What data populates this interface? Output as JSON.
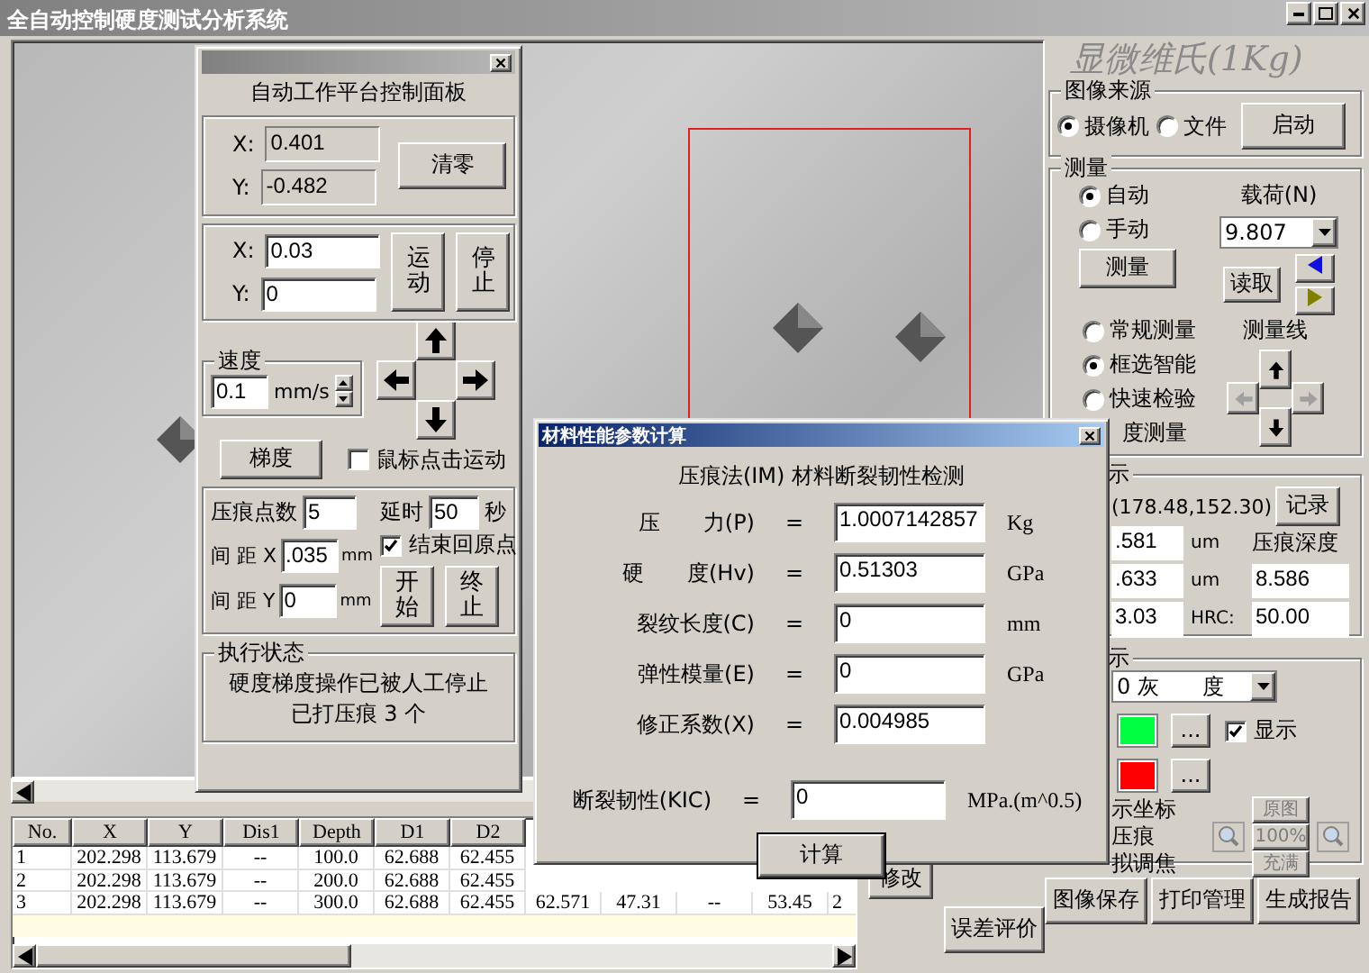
{
  "window": {
    "title": "全自动控制硬度测试分析系统"
  },
  "stage_panel": {
    "title": "自动工作平台控制面板",
    "readout": [
      {
        "label": "X:",
        "value": "0.401"
      },
      {
        "label": "Y:",
        "value": "-0.482"
      }
    ],
    "zero_button": "清零",
    "target": [
      {
        "label": "X:",
        "value": "0.03"
      },
      {
        "label": "Y:",
        "value": "0"
      }
    ],
    "move_button": "运动",
    "stop_button": "停止",
    "speed": {
      "title": "速度",
      "value": "0.1",
      "unit": "mm/s"
    },
    "gradient_button": "梯度",
    "click_move": {
      "label": "鼠标点击运动",
      "checked": false
    },
    "points": {
      "label": "压痕点数",
      "value": "5"
    },
    "delay": {
      "label": "延时",
      "value": "50",
      "unit": "秒"
    },
    "return_origin": {
      "label": "结束回原点",
      "checked": true
    },
    "spacing": [
      {
        "label": "间 距 X",
        "value": ".035",
        "unit": "mm"
      },
      {
        "label": "间 距 Y",
        "value": "0",
        "unit": "mm"
      }
    ],
    "start_button": "开始",
    "end_button": "终止",
    "status": {
      "title": "执行状态",
      "lines": [
        "硬度梯度操作已被人工停止",
        "已打压痕 3 个"
      ]
    }
  },
  "table": {
    "columns": [
      "No.",
      "X",
      "Y",
      "Dis1",
      "Depth",
      "D1",
      "D2"
    ],
    "rows": [
      {
        "cells": [
          "1",
          "202.298",
          "113.679",
          "--",
          "100.0",
          "62.688",
          "62.455"
        ]
      },
      {
        "cells": [
          "2",
          "202.298",
          "113.679",
          "--",
          "200.0",
          "62.688",
          "62.455"
        ]
      },
      {
        "cells": [
          "3",
          "202.298",
          "113.679",
          "--",
          "300.0",
          "62.688",
          "62.455",
          "62.571",
          "47.31",
          "--",
          "53.45",
          "2"
        ]
      }
    ]
  },
  "right_panel": {
    "brand": "显微维氏(1Kg)",
    "source": {
      "title": "图像来源",
      "options": [
        {
          "label": "摄像机",
          "selected": true
        },
        {
          "label": "文件",
          "selected": false
        }
      ],
      "button": "启动"
    },
    "measure": {
      "title": "测量",
      "modes": [
        {
          "label": "自动",
          "selected": true
        },
        {
          "label": "手动",
          "selected": false
        }
      ],
      "load_label": "载荷(N)",
      "load_value": "9.807",
      "measure_button": "测量",
      "read_button": "读取",
      "methods": [
        {
          "label": "常规测量",
          "selected": false
        },
        {
          "label": "框选智能",
          "selected": true
        },
        {
          "label": "快速检验",
          "selected": false
        },
        {
          "label": "度测量"
        }
      ],
      "line_label": "测量线",
      "line_arrows": [
        {
          "kind": "left",
          "disabled": true
        },
        {
          "kind": "up",
          "disabled": false
        },
        {
          "kind": "down",
          "disabled": false
        },
        {
          "kind": "right",
          "disabled": true
        }
      ]
    },
    "result": {
      "title": "示",
      "coords": "(178.48,152.30)",
      "record_button": "记录",
      "depth_label": "压痕深度",
      "rows": [
        {
          "value": ".581",
          "unit": "um"
        },
        {
          "value": ".633",
          "unit": "um",
          "extra": "8.586"
        },
        {
          "value": "3.03",
          "unit": "HRC:",
          "extra": "50.00"
        }
      ]
    },
    "display": {
      "title": "示",
      "mode_value": "0 灰　　度",
      "colors": [
        {
          "color": "#00ff40",
          "button": "..."
        },
        {
          "color": "#ff0000",
          "button": "..."
        }
      ],
      "show": {
        "label": "显示",
        "checked": true
      },
      "options": [
        "示坐标",
        "压痕",
        "拟调焦"
      ],
      "zoom": [
        {
          "label": "原图",
          "disabled": true
        },
        {
          "label": "100%",
          "disabled": true
        },
        {
          "label": "充满",
          "disabled": true
        }
      ]
    },
    "buttons": [
      "修改",
      "误差评价",
      "图像保存",
      "打印管理",
      "生成报告"
    ]
  },
  "dialog": {
    "title": "材料性能参数计算",
    "heading": "压痕法(IM) 材料断裂韧性检测",
    "rows": [
      {
        "label": "压　　力(P)",
        "sign": "=",
        "value": "1.0007142857",
        "unit": "Kg"
      },
      {
        "label": "硬　　度(Hv)",
        "sign": "=",
        "value": "0.51303",
        "unit": "GPa"
      },
      {
        "label": "裂纹长度(C)",
        "sign": "=",
        "value": "0",
        "unit": "mm"
      },
      {
        "label": "弹性模量(E)",
        "sign": "=",
        "value": "0",
        "unit": "GPa"
      },
      {
        "label": "修正系数(X)",
        "sign": "=",
        "value": "0.004985"
      }
    ],
    "result": {
      "label": "断裂韧性(KIC)",
      "sign": "=",
      "value": "0",
      "unit": "MPa.(m^0.5)"
    },
    "button": "计算"
  }
}
